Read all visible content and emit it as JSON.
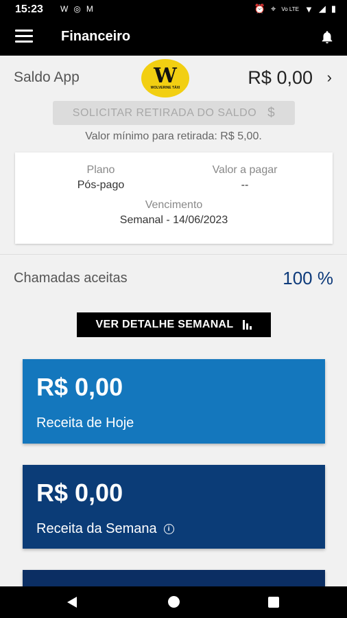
{
  "status_bar": {
    "time": "15:23",
    "left_icons": [
      "W",
      "instagram",
      "M"
    ],
    "right_icons": [
      "alarm",
      "location",
      "Vo LTE",
      "wifi",
      "4G",
      "signal",
      "battery"
    ]
  },
  "app_bar": {
    "title": "Financeiro",
    "menu_icon": "hamburger-icon",
    "bell_icon": "bell-icon"
  },
  "balance": {
    "label": "Saldo App",
    "logo_letter": "W",
    "logo_text": "WOLVERINE TÁXI",
    "amount": "R$ 0,00",
    "chevron": "›"
  },
  "withdraw": {
    "button_label": "SOLICITAR RETIRADA DO SALDO",
    "button_icon": "$",
    "min_note": "Valor mínimo para retirada: R$ 5,00."
  },
  "plan": {
    "plan_label": "Plano",
    "plan_value": "Pós-pago",
    "due_label": "Valor a pagar",
    "due_value": "--",
    "expiry_label": "Vencimento",
    "expiry_value": "Semanal - 14/06/2023"
  },
  "calls": {
    "label": "Chamadas aceitas",
    "value": "100 %"
  },
  "weekly_button": {
    "label": "VER DETALHE SEMANAL"
  },
  "cards": {
    "today": {
      "amount": "R$ 0,00",
      "caption": "Receita de Hoje"
    },
    "week": {
      "amount": "R$ 0,00",
      "caption": "Receita da Semana",
      "info": "i"
    }
  },
  "colors": {
    "today_card": "#1477bd",
    "week_card": "#0b3c77",
    "accent_text": "#0d3a7a",
    "logo_yellow": "#f2cf12"
  }
}
